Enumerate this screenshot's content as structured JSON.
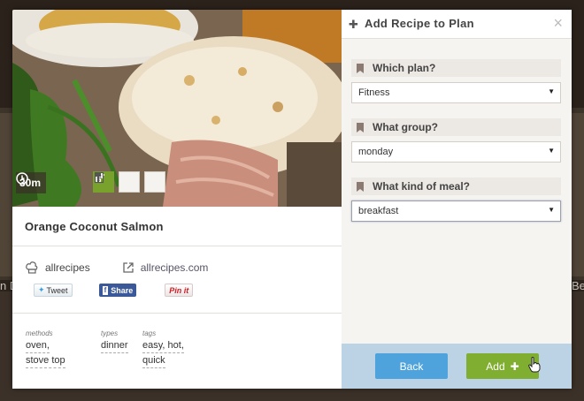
{
  "background": {
    "left_partial_text": "n D",
    "right_partial_text": "Be"
  },
  "recipe": {
    "image_alt": "Orange coconut salmon dish",
    "time": "30m",
    "time_icon": "clock-icon",
    "actions": [
      "add-to-plan-icon",
      "hammer-icon",
      "recipe-card-icon"
    ],
    "title": "Orange Coconut Salmon",
    "source_name": "allrecipes",
    "source_icon": "chef-hat-icon",
    "source_link": "allrecipes.com",
    "source_link_icon": "external-link-icon",
    "share": {
      "tweet": "Tweet",
      "facebook": "Share",
      "pinterest": "Pin it"
    },
    "meta": {
      "methods_label": "methods",
      "methods": [
        "oven,",
        "stove top"
      ],
      "types_label": "types",
      "types": [
        "dinner"
      ],
      "tags_label": "tags",
      "tags": [
        "easy, hot,",
        "quick"
      ]
    }
  },
  "plan_panel": {
    "title": "Add Recipe to Plan",
    "questions": [
      {
        "label": "Which plan?",
        "value": "Fitness"
      },
      {
        "label": "What group?",
        "value": "monday"
      },
      {
        "label": "What kind of meal?",
        "value": "breakfast"
      }
    ],
    "back_label": "Back",
    "add_label": "Add"
  },
  "colors": {
    "accent_green": "#80ae30",
    "accent_blue": "#4fa3dc",
    "footer_bg": "#bcd3e6"
  }
}
